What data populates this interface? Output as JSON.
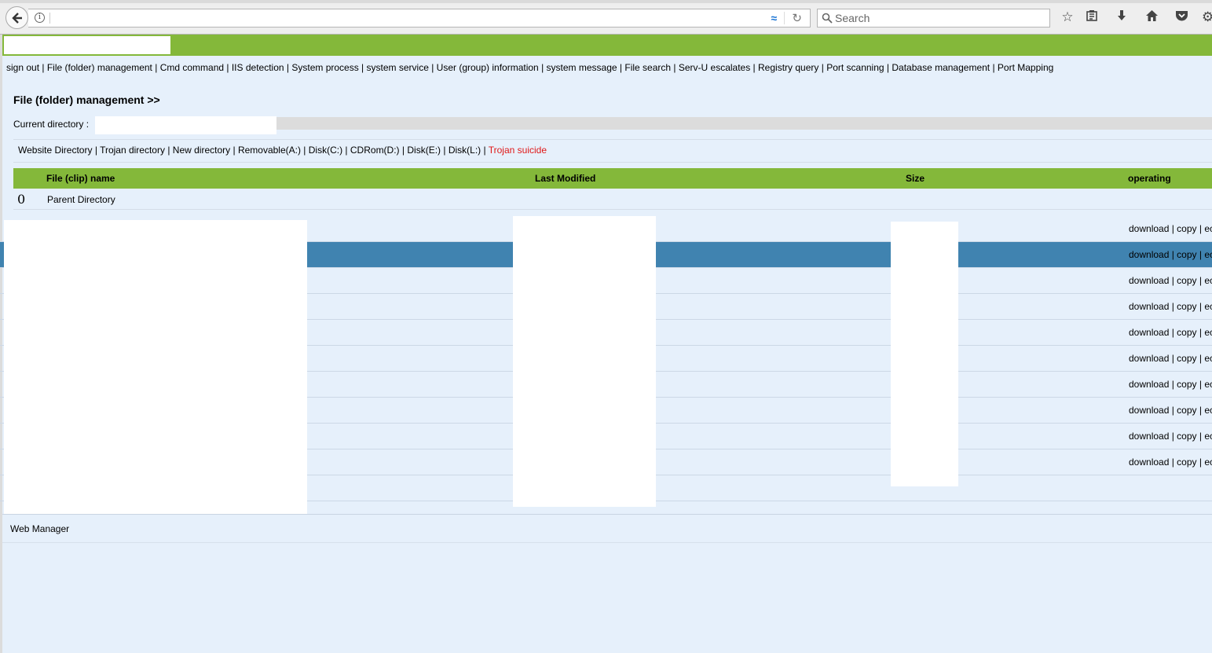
{
  "browser": {
    "search_placeholder": "Search",
    "reader_glyph": "≈",
    "reload_glyph": "↻"
  },
  "nav": [
    "sign out",
    "File (folder) management",
    "Cmd command",
    "IIS detection",
    "System process",
    "system service",
    "User (group) information",
    "system message",
    "File search",
    "Serv-U escalates",
    "Registry query",
    "Port scanning",
    "Database management",
    "Port Mapping"
  ],
  "section": {
    "title": "File (folder) management >>",
    "current_dir_label": "Current directory :"
  },
  "quicklinks": [
    {
      "label": "Website Directory",
      "danger": false
    },
    {
      "label": "Trojan directory",
      "danger": false
    },
    {
      "label": "New directory",
      "danger": false
    },
    {
      "label": "Removable(A:)",
      "danger": false
    },
    {
      "label": "Disk(C:)",
      "danger": false
    },
    {
      "label": "CDRom(D:)",
      "danger": false
    },
    {
      "label": "Disk(E:)",
      "danger": false
    },
    {
      "label": "Disk(L:)",
      "danger": false
    },
    {
      "label": "Trojan suicide",
      "danger": true
    }
  ],
  "table": {
    "headers": {
      "name": "File (clip) name",
      "modified": "Last Modified",
      "size": "Size",
      "ops": "operating"
    },
    "parent": {
      "icon": "0",
      "name": "Parent Directory"
    },
    "row_ops": {
      "download": "download",
      "copy": "copy",
      "edit": "ec"
    },
    "file_rows": [
      {
        "ops": true,
        "selected": false
      },
      {
        "ops": true,
        "selected": true
      },
      {
        "ops": true,
        "selected": false
      },
      {
        "ops": true,
        "selected": false
      },
      {
        "ops": true,
        "selected": false
      },
      {
        "ops": true,
        "selected": false
      },
      {
        "ops": true,
        "selected": false
      },
      {
        "ops": true,
        "selected": false
      },
      {
        "ops": true,
        "selected": false
      },
      {
        "ops": true,
        "selected": false
      },
      {
        "ops": false,
        "selected": false
      }
    ]
  },
  "footer": {
    "text": "Web Manager"
  },
  "colors": {
    "header_green": "#84b83a",
    "page_bg": "#e6f0fb",
    "selected_row": "#4083b0",
    "danger_link": "#e01818"
  }
}
